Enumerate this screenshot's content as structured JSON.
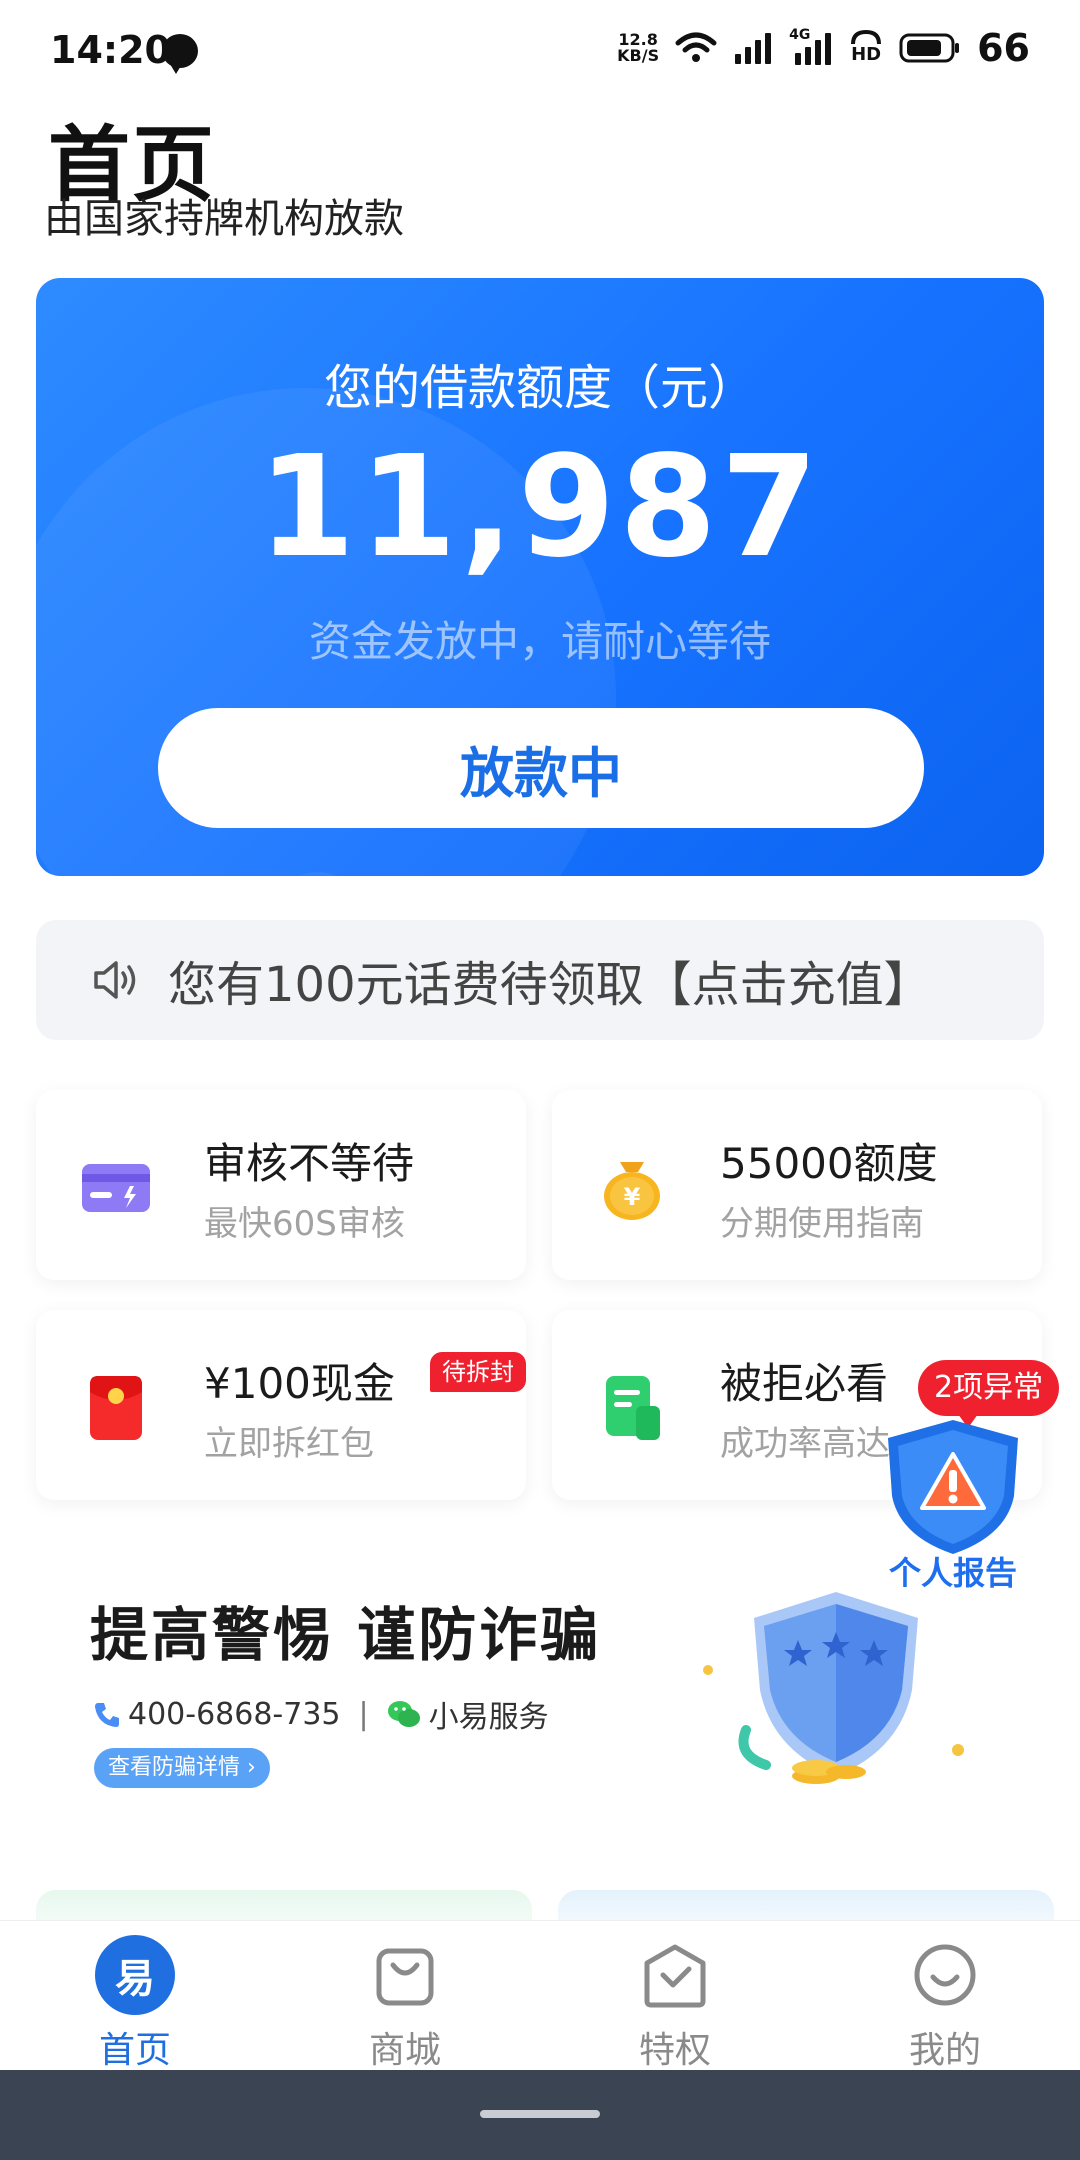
{
  "status_bar": {
    "time": "14:20",
    "net_speed_value": "12.8",
    "net_speed_unit": "KB/S",
    "network_label": "4G",
    "hd_label": "HD",
    "battery": "66"
  },
  "header": {
    "title": "首页",
    "subtitle": "由国家持牌机构放款"
  },
  "credit_card": {
    "label": "您的借款额度（元）",
    "amount": "11,987",
    "note": "资金发放中，请耐心等待",
    "button_label": "放款中"
  },
  "notice": {
    "text": "您有100元话费待领取【点击充值】"
  },
  "tiles": [
    {
      "title": "审核不等待",
      "subtitle": "最快60S审核",
      "icon": "card-icon"
    },
    {
      "title": "55000额度",
      "subtitle": "分期使用指南",
      "icon": "money-bag-icon"
    },
    {
      "title": "¥100现金",
      "subtitle": "立即拆红包",
      "icon": "red-envelope-icon",
      "badge": "待拆封"
    },
    {
      "title": "被拒必看",
      "subtitle": "成功率高达",
      "icon": "document-icon"
    }
  ],
  "report_float": {
    "badge": "2项异常",
    "label": "个人报告"
  },
  "fraud_banner": {
    "title": "提高警惕 谨防诈骗",
    "phone": "400-6868-735",
    "separator": "|",
    "service": "小易服务",
    "link": "查看防骗详情 ›"
  },
  "bottom_nav": {
    "logo_char": "易",
    "items": [
      {
        "label": "首页",
        "active": true
      },
      {
        "label": "商城",
        "active": false
      },
      {
        "label": "特权",
        "active": false
      },
      {
        "label": "我的",
        "active": false
      }
    ]
  },
  "colors": {
    "primary": "#1773ff",
    "accent_red": "#f0212f",
    "nav_active": "#1f6fe0"
  }
}
